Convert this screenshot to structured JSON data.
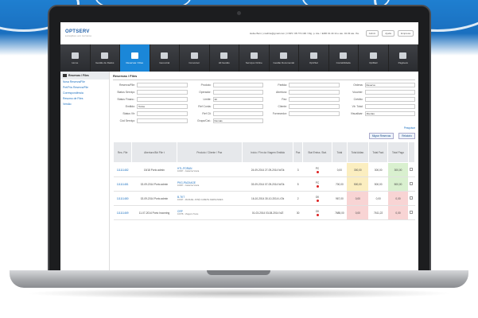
{
  "app": {
    "logo": "OPTSERV",
    "logo_sub": "soluções em turismo",
    "user_line": "Heike Bern | cowhite@gmail.com | CNPJ: 08.774.190 / Dig. p. Ate. / ERR 01.43.14 e ate. 04.03 ate. Ihs.",
    "top_buttons": [
      "Admin",
      "Ajuda",
      "Empresa"
    ]
  },
  "nav": [
    {
      "label": "Home",
      "icon": "home-icon"
    },
    {
      "label": "Gestão de Dados",
      "icon": "database-icon"
    },
    {
      "label": "Reservas / Files",
      "icon": "folder-icon",
      "active": true
    },
    {
      "label": "Gerencial",
      "icon": "report-icon"
    },
    {
      "label": "Conversor",
      "icon": "convert-icon"
    },
    {
      "label": "Hil Gestão",
      "icon": "chart-icon"
    },
    {
      "label": "Serviços Online",
      "icon": "cloud-icon"
    },
    {
      "label": "Gestão Documental",
      "icon": "document-icon"
    },
    {
      "label": "OptVital",
      "icon": "pulse-icon"
    },
    {
      "label": "Contabilidade",
      "icon": "ledger-icon"
    },
    {
      "label": "OptMail",
      "icon": "mail-icon"
    },
    {
      "label": "Pagáveis",
      "icon": "pay-icon"
    }
  ],
  "sidebar": {
    "title": "Reservas / Files",
    "links": [
      "Nova Reserva/File",
      "Pré/Pós Reserva/File",
      "Correspondência",
      "Resumo de Files",
      "Versão"
    ]
  },
  "main": {
    "title": "Reservas / Files",
    "fields": [
      {
        "label": "Reserva/File:",
        "value": ""
      },
      {
        "label": "Produto:",
        "value": ""
      },
      {
        "label": "Partida:",
        "value": ""
      },
      {
        "label": "Ordena:",
        "value": "Reserva"
      },
      {
        "label": "Status Serviço:",
        "value": ""
      },
      {
        "label": "Operador:",
        "value": ""
      },
      {
        "label": "Abertura:",
        "value": ""
      },
      {
        "label": "Voucher:",
        "value": ""
      },
      {
        "label": "Status Financ.:",
        "value": ""
      },
      {
        "label": "Limite:",
        "value": "30"
      },
      {
        "label": "Pax:",
        "value": ""
      },
      {
        "label": "Crédito:",
        "value": ""
      },
      {
        "label": "Emitido:",
        "value": "Todos"
      },
      {
        "label": "Ref Conta:",
        "value": ""
      },
      {
        "label": "Cliente:",
        "value": ""
      },
      {
        "label": "Vlr. Total:",
        "value": ""
      },
      {
        "label": "Status Vlr:",
        "value": ""
      },
      {
        "label": "Ref Cli:",
        "value": ""
      },
      {
        "label": "Fornecedor:",
        "value": ""
      },
      {
        "label": "Visualizar:",
        "value": "Abertas"
      },
      {
        "label": "Cód Serviço:",
        "value": ""
      },
      {
        "label": "Grupo/Cat.:",
        "value": "Demais"
      }
    ],
    "search_label": "Pesquisar",
    "actions": [
      "Migrar Reservas",
      "Relatorio"
    ],
    "columns": [
      "Res. File",
      "Abertura Bkt File t",
      "Produto / Cliente / Pax",
      "Início / Fim da Viagem Emitido",
      "Pax",
      "Stat Emiss. Stat.",
      "Total",
      "Total Adian.",
      "Total Fact.",
      "Total Pago",
      ""
    ],
    "rows": [
      {
        "code": "111111482",
        "open": "15/18 Porto admin",
        "product": "HTL-PORAN",
        "client": "10067 - Catarina Vieira",
        "dates": "24-09-2014 27-09-2014 N/Ok",
        "pax": "3",
        "stat": "PC",
        "total": "0,00",
        "adian": "300,00",
        "fact": "300,00",
        "paid": "300,00",
        "adian_color": "amber",
        "paid_color": "green"
      },
      {
        "code": "111111481",
        "open": "02-09-2014 Porto admin",
        "product": "PKG-PACKAGE",
        "client": "10067 - Catarina Vieira",
        "dates": "03-09-2014 07-09-2014 N/Ok",
        "pax": "5",
        "stat": "PC",
        "total": "700,00",
        "adian": "500,00",
        "fact": "500,00",
        "paid": "500,00",
        "adian_color": "amber",
        "paid_color": "green"
      },
      {
        "code": "111111480",
        "open": "02-09-2014 Porto admin",
        "product": "B-TKT",
        "client": "10047 - MANUEL JOSÉ CAMETE FERNANDES",
        "dates": "16-10-2014 30-10-2014 L/Ok",
        "pax": "2",
        "stat": "OK",
        "total": "967,00",
        "adian": "0,00",
        "fact": "0,00",
        "paid": "0,00",
        "adian_color": "red",
        "paid_color": "red"
      },
      {
        "code": "111111469",
        "open": "11-07-2014 Porto Incoming",
        "product": "CRP",
        "client": "10078 - Viagens Teste",
        "dates": "01-03-2014 03-08-2014 N/Z",
        "pax": "30",
        "stat": "OK",
        "total": "7685,00",
        "adian": "0,00",
        "fact": "7611,22",
        "paid": "0,00",
        "adian_color": "red",
        "paid_color": "red"
      }
    ]
  }
}
